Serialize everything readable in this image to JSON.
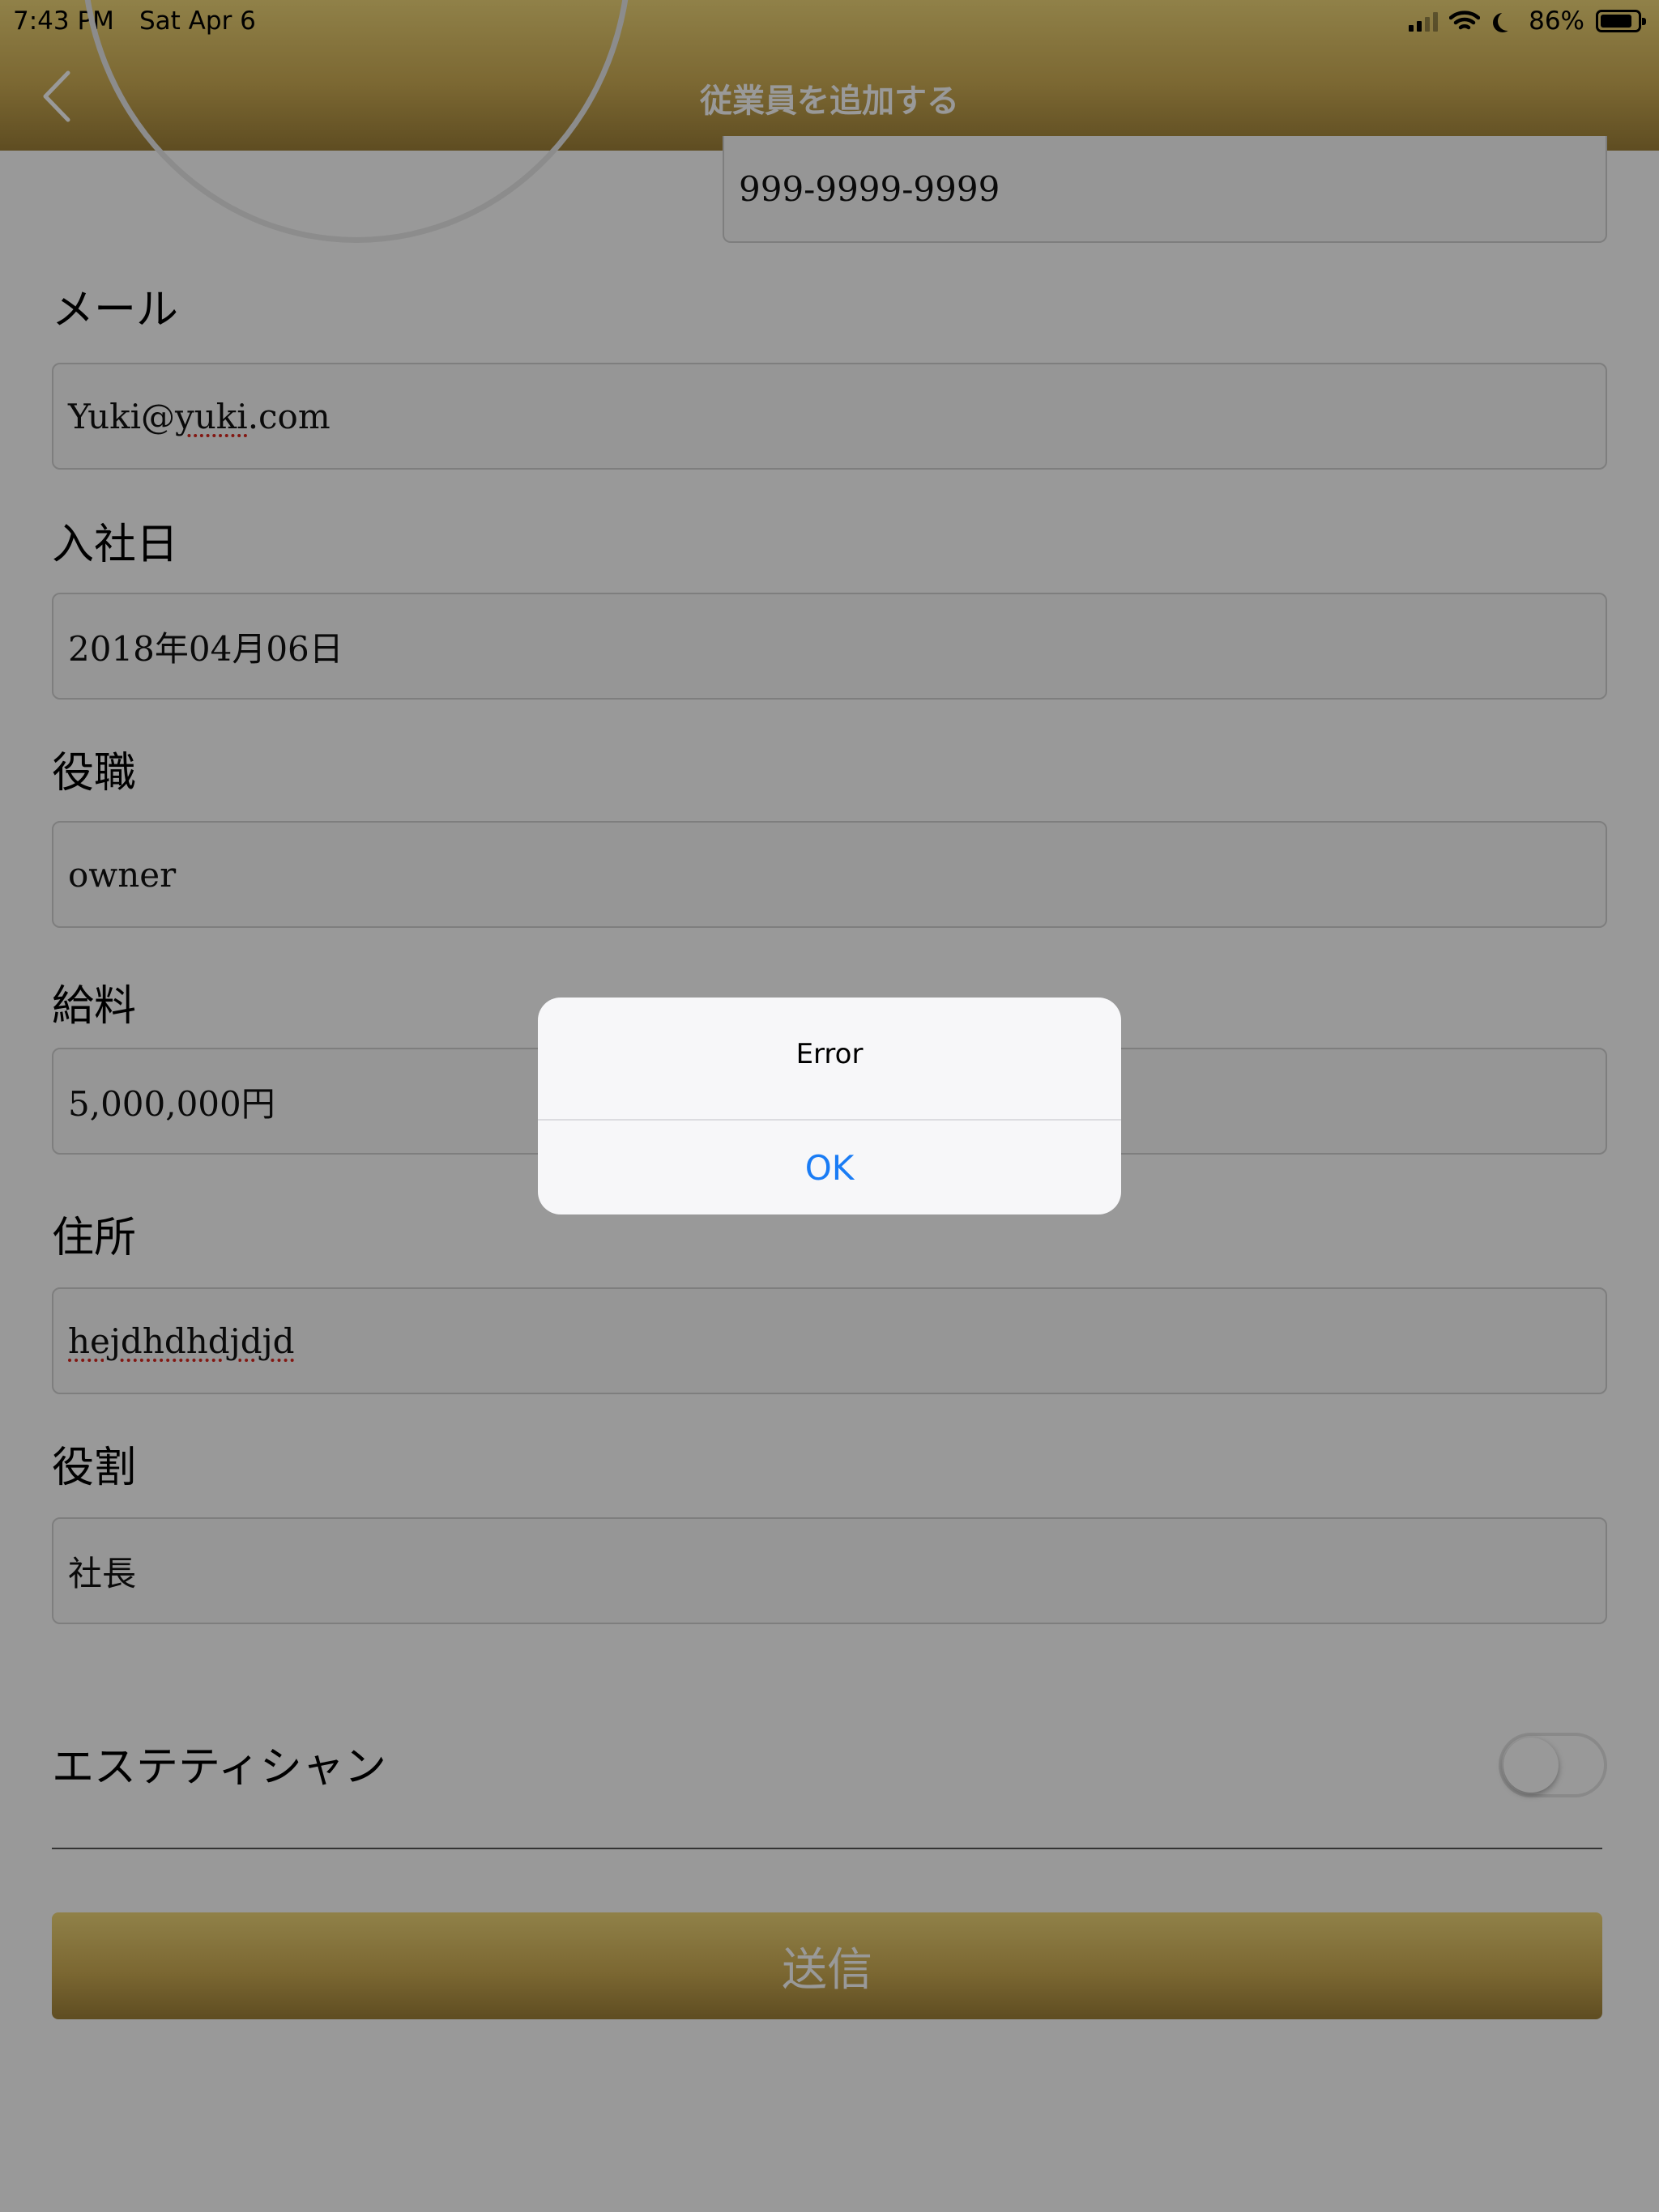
{
  "status_bar": {
    "time": "7:43 PM",
    "date": "Sat Apr 6",
    "battery": "86%",
    "battery_level": 0.86
  },
  "header": {
    "title": "従業員を追加する",
    "back_icon": "chevron-left-icon"
  },
  "form": {
    "phone_value": "999-9999-9999",
    "email": {
      "label": "メール",
      "value": "Yuki@yuki.com"
    },
    "hire_date": {
      "label": "入社日",
      "value": "2018年04月06日"
    },
    "position": {
      "label": "役職",
      "value": "owner"
    },
    "salary": {
      "label": "給料",
      "value": "5,000,000円"
    },
    "address": {
      "label": "住所",
      "value": "hejdhdhdjdjd"
    },
    "role": {
      "label": "役割",
      "value": "社長"
    },
    "esthetician": {
      "label": "エステティシャン",
      "enabled": false
    },
    "submit_label": "送信"
  },
  "alert": {
    "title": "Error",
    "ok_label": "OK"
  },
  "colors": {
    "header_gold": "#cfae55",
    "alert_button": "#1a7cf5"
  }
}
